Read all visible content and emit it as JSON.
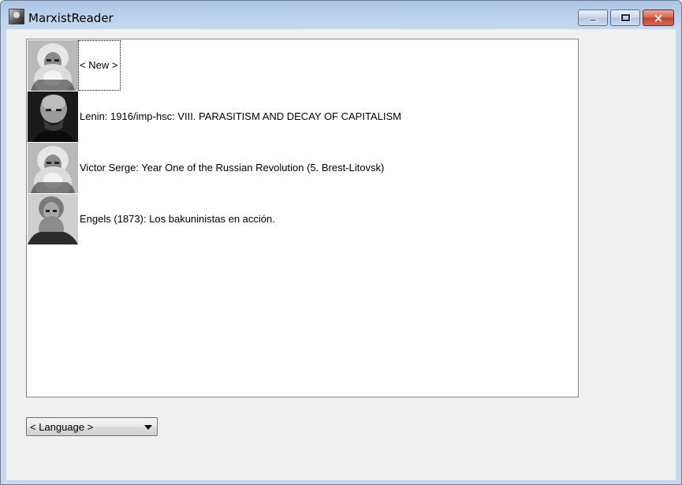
{
  "window": {
    "title": "MarxistReader",
    "icon": "marx-portrait-icon",
    "controls": {
      "minimize": "minimize-icon",
      "maximize": "maximize-icon",
      "close": "×"
    }
  },
  "list": {
    "items": [
      {
        "portrait": "marx-portrait",
        "label": "< New >",
        "focused": true
      },
      {
        "portrait": "lenin-portrait",
        "label": "Lenin: 1916/imp-hsc: VIII. PARASITISM AND DECAY OF CAPITALISM"
      },
      {
        "portrait": "marx-portrait",
        "label": "Victor Serge: Year One of the Russian Revolution (5. Brest-Litovsk)"
      },
      {
        "portrait": "engels-portrait",
        "label": "Engels (1873): Los bakuninistas en acción."
      }
    ]
  },
  "language": {
    "selected": "< Language >"
  },
  "colors": {
    "title_gradient": "#bcd3ee",
    "close_red": "#c0402a",
    "client_bg": "#f0f0f0"
  }
}
